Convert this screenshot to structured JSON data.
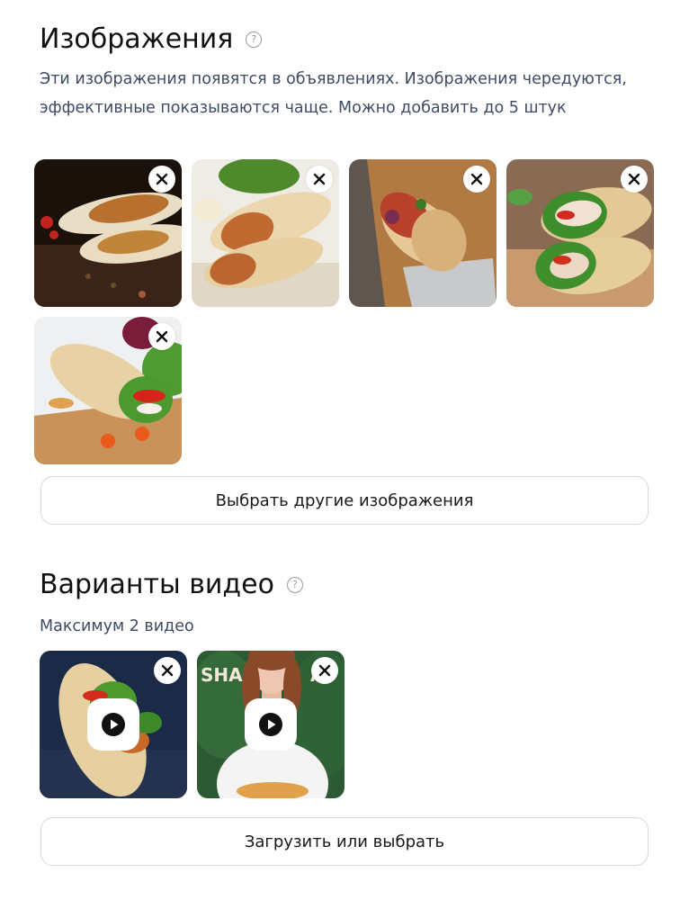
{
  "images_section": {
    "title": "Изображения",
    "help_icon": "question-circle-icon",
    "description": "Эти изображения появятся в объявлениях. Изображения чередуются, эффективные показываются чаще. Можно добавить до 5 штук",
    "items": [
      {
        "content": "shawarma-on-dark-table",
        "remove_icon": "close-icon"
      },
      {
        "content": "shawarma-on-paper-with-greens",
        "remove_icon": "close-icon"
      },
      {
        "content": "shawarma-in-foil-on-board",
        "remove_icon": "close-icon"
      },
      {
        "content": "chicken-wrap-halves",
        "remove_icon": "close-icon"
      },
      {
        "content": "tortilla-wrap-with-salad",
        "remove_icon": "close-icon"
      }
    ],
    "choose_button_label": "Выбрать другие изображения"
  },
  "video_section": {
    "title": "Варианты видео",
    "help_icon": "question-circle-icon",
    "description": "Максимум 2 видео",
    "items": [
      {
        "content": "wrap-video-thumbnail",
        "play_icon": "play-icon",
        "remove_icon": "close-icon"
      },
      {
        "content": "woman-presenter-video-thumbnail",
        "play_icon": "play-icon",
        "remove_icon": "close-icon"
      }
    ],
    "upload_button_label": "Загрузить или выбрать"
  },
  "colors": {
    "description_text": "#3f4a66",
    "button_border": "#d6d8de",
    "help_icon": "#9a9aa2"
  }
}
